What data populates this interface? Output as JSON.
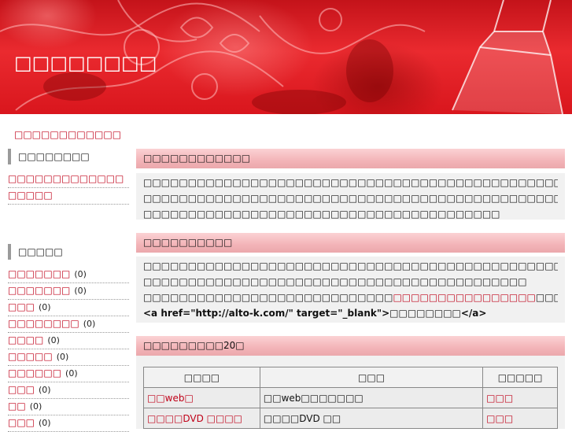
{
  "header": {
    "site_title": "□□□□□□□□"
  },
  "breadcrumb": "□□□□□□□□□□□□",
  "sidebar": {
    "section1": {
      "heading": "□□□□□□□□",
      "links": [
        {
          "label": "□□□□□□□□□□□□□"
        },
        {
          "label": "□□□□□"
        }
      ]
    },
    "section2": {
      "heading": "□□□□□",
      "categories": [
        {
          "label": "□□□□□□□",
          "count": "(0)"
        },
        {
          "label": "□□□□□□□",
          "count": "(0)"
        },
        {
          "label": "□□□",
          "count": "(0)"
        },
        {
          "label": "□□□□□□□□",
          "count": "(0)"
        },
        {
          "label": "□□□□",
          "count": "(0)"
        },
        {
          "label": "□□□□□",
          "count": "(0)"
        },
        {
          "label": "□□□□□□",
          "count": "(0)"
        },
        {
          "label": "□□□",
          "count": "(0)"
        },
        {
          "label": "□□",
          "count": "(0)"
        },
        {
          "label": "□□□",
          "count": "(0)"
        }
      ]
    }
  },
  "main": {
    "section1": {
      "heading": "□□□□□□□□□□□□",
      "lines": [
        "□□□□□□□□□□□□□□□□□□□□□□□□□□□□□□□□□□□□□□□□□□□□□□□□□□□□□□□□□□□□□□□□□□□□□",
        "□□□□□□□□□□□□□□□□□□□□□□□□□□□□□□□□□□□□□□□□□□□□□□□□□□□□□□□□□□□□□□□□□□□□□",
        "□□□□□□□□□□□□□□□□□□□□□□□□□□□□□□□□□□□□□□□□"
      ]
    },
    "section2": {
      "heading": "□□□□□□□□□□",
      "lines": [
        "□□□□□□□□□□□□□□□□□□□□□□□□□□□□□□□□□□□□□□□□□□□□□□□□□□□□□",
        "□□□□□□□□□□□□□□□□□□□□□□□□□□□□□□□□□□□□□□□□□□□",
        "□□□□□□□□□□□□□□□□□□□□□□□□□□□□□□□□□□□□□□□□□□□"
      ],
      "line3_prefix": "□□□□□□□□□□□□□□□□□□□□□□□□□□□□",
      "line3_link": "□□□□□□□□□□□□□□□□",
      "line3_suffix": "□□□□□□□□□□□",
      "code_line": "<a href=\"http://alto-k.com/\" target=\"_blank\">□□□□□□□□</a>"
    },
    "section3": {
      "heading": "□□□□□□□□□20□",
      "table": {
        "headers": [
          "□□□□",
          "□□□",
          "□□□□□"
        ],
        "rows": [
          [
            "□□web□",
            "□□web□□□□□□□",
            "□□□"
          ],
          [
            "□□□□DVD □□□□",
            "□□□□DVD □□",
            "□□□"
          ]
        ]
      }
    }
  },
  "colors": {
    "accent": "#c00018",
    "banner": "#e0252b",
    "section_header": "#f3b4b8"
  }
}
